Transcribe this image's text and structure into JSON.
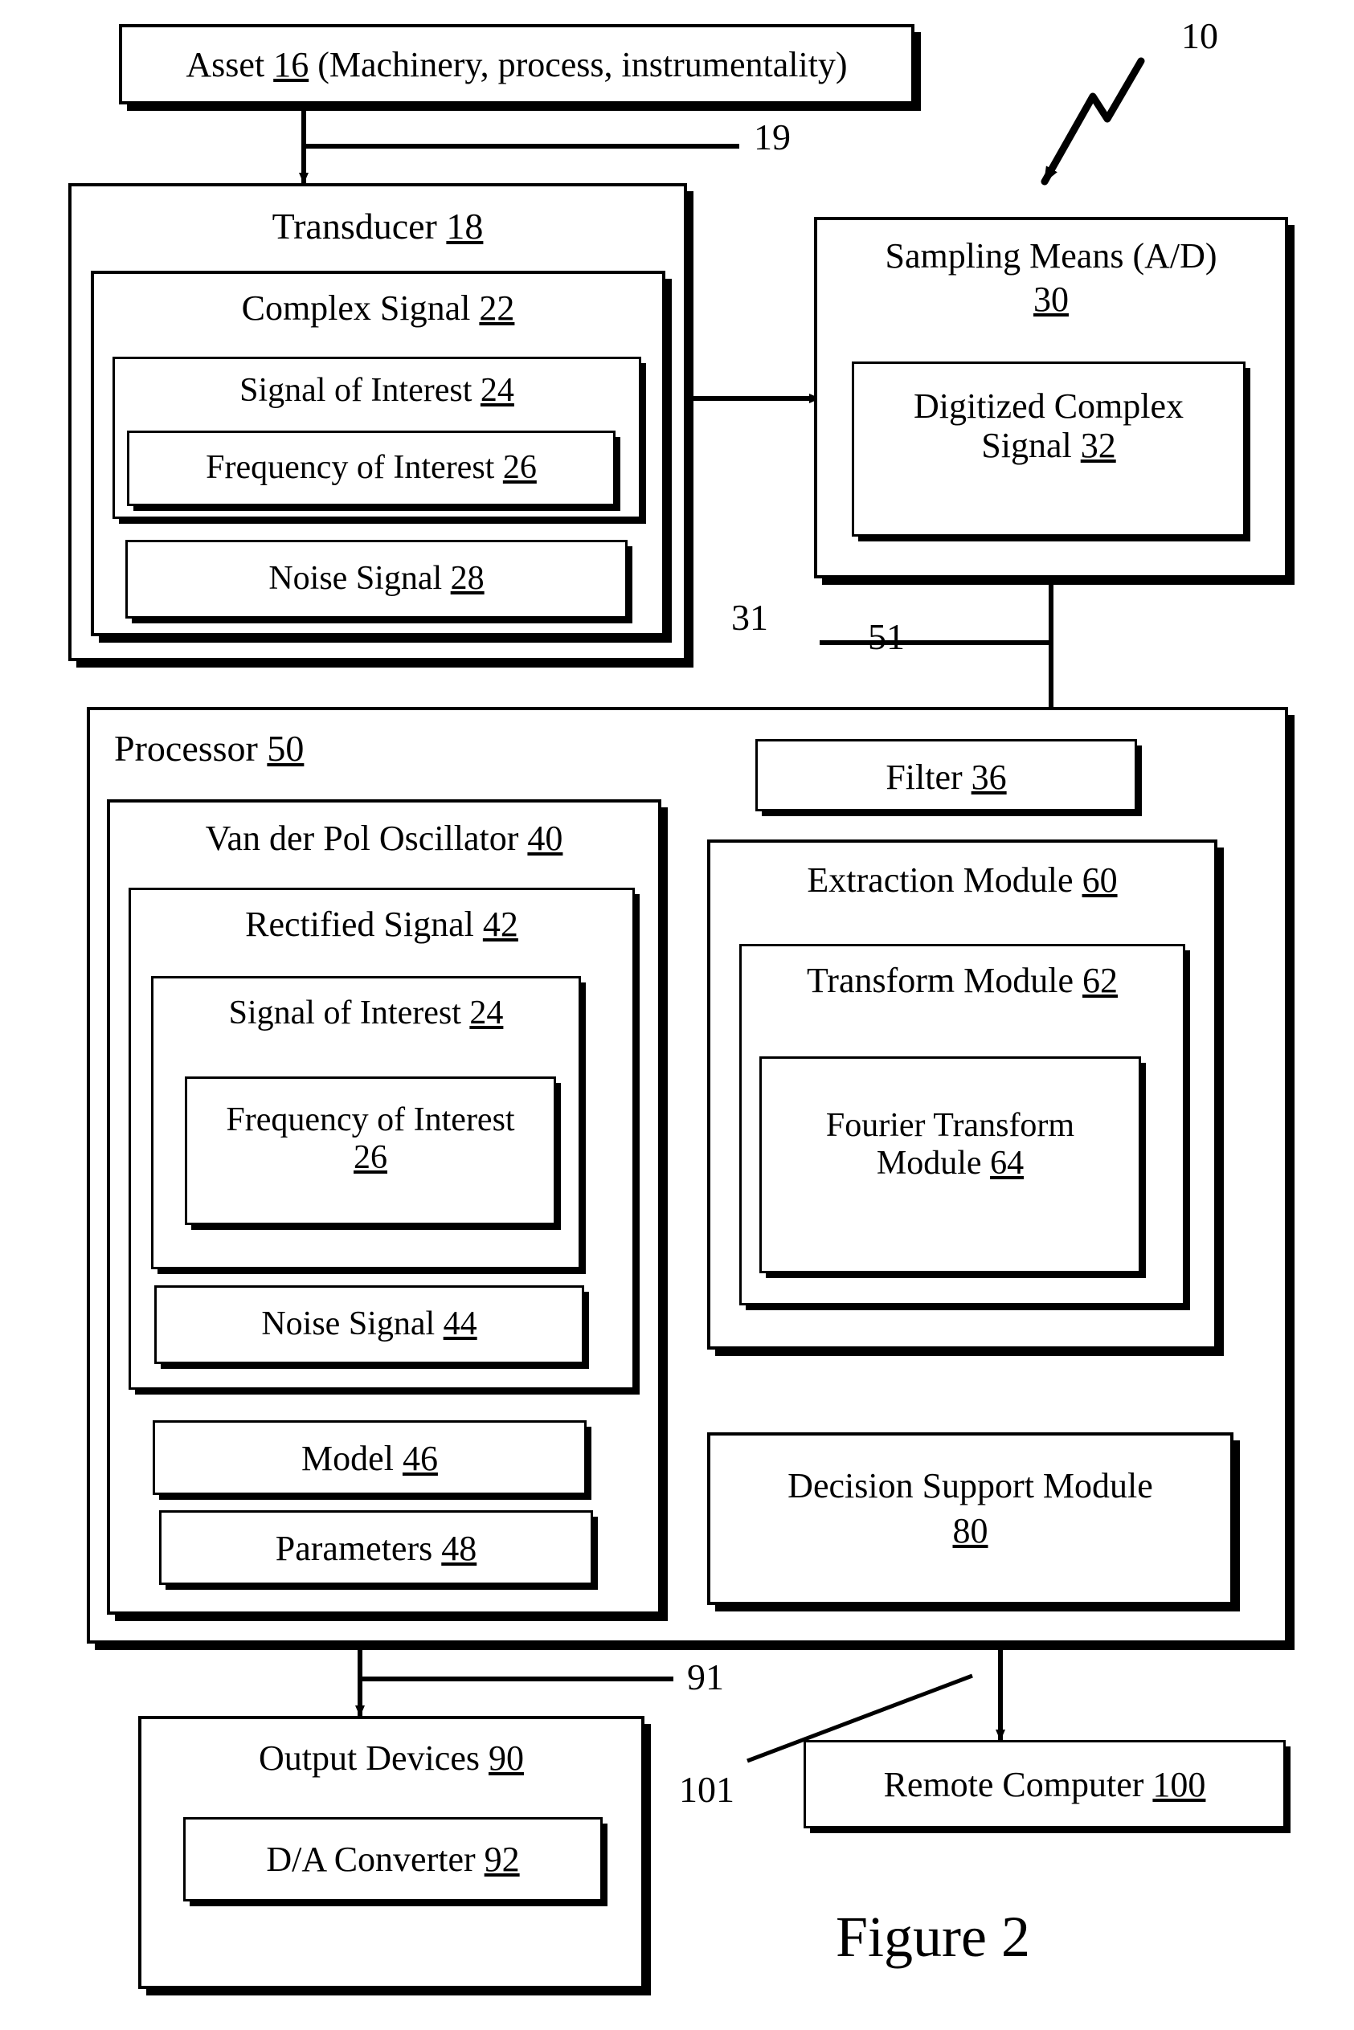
{
  "figure": {
    "caption": "Figure 2",
    "system_ref": "10"
  },
  "boxes": {
    "asset": {
      "title": "Asset ",
      "ref": "16",
      "suffix": " (Machinery, process, instrumentality)"
    },
    "transducer": {
      "title": "Transducer ",
      "ref": "18"
    },
    "complex_signal": {
      "title": "Complex Signal ",
      "ref": "22"
    },
    "signal_of_interest_top": {
      "title": "Signal of Interest ",
      "ref": "24"
    },
    "frequency_of_interest_top": {
      "title": "Frequency of Interest ",
      "ref": "26"
    },
    "noise_signal_top": {
      "title": "Noise Signal ",
      "ref": "28"
    },
    "sampling_means": {
      "title": "Sampling Means (A/D)",
      "ref": "30"
    },
    "digitized_complex_signal": {
      "title": "Digitized Complex Signal ",
      "ref": "32"
    },
    "processor": {
      "title": "Processor ",
      "ref": "50"
    },
    "filter": {
      "title": "Filter ",
      "ref": "36"
    },
    "vdp_oscillator": {
      "title": "Van der Pol Oscillator ",
      "ref": "40"
    },
    "rectified_signal": {
      "title": "Rectified Signal ",
      "ref": "42"
    },
    "signal_of_interest_bottom": {
      "title": "Signal of Interest ",
      "ref": "24"
    },
    "frequency_of_interest_bottom": {
      "title": "Frequency of Interest ",
      "ref": "26"
    },
    "noise_signal_bottom": {
      "title": "Noise Signal ",
      "ref": "44"
    },
    "model": {
      "title": "Model ",
      "ref": "46"
    },
    "parameters": {
      "title": "Parameters ",
      "ref": "48"
    },
    "extraction_module": {
      "title": "Extraction Module ",
      "ref": "60"
    },
    "transform_module": {
      "title": "Transform Module ",
      "ref": "62"
    },
    "fourier_transform_module": {
      "title": "Fourier Transform Module ",
      "ref": "64"
    },
    "decision_support_module": {
      "title": "Decision Support Module ",
      "ref": "80"
    },
    "output_devices": {
      "title": "Output Devices ",
      "ref": "90"
    },
    "da_converter": {
      "title": "D/A Converter ",
      "ref": "92"
    },
    "remote_computer": {
      "title": "Remote Computer ",
      "ref": "100"
    }
  },
  "connectors": {
    "asset_to_transducer": "19",
    "transducer_to_sampling": "31",
    "sampling_to_processor": "51",
    "processor_to_output": "91",
    "processor_to_remote": "101"
  },
  "colors": {
    "ink": "#000000",
    "paper": "#ffffff"
  }
}
